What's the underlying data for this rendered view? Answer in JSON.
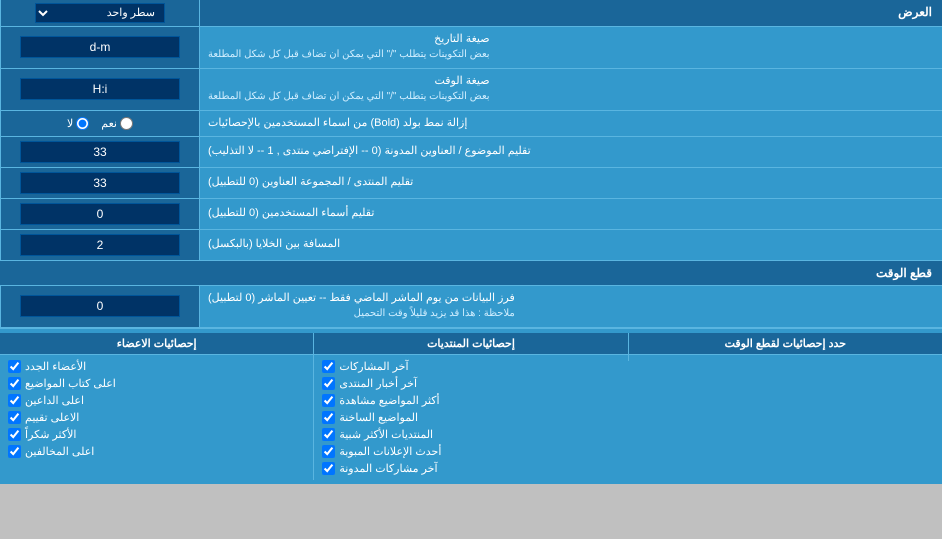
{
  "header": {
    "label": "العرض",
    "dropdown_label": "سطر واحد"
  },
  "rows": [
    {
      "id": "date-format",
      "label": "صيغة التاريخ",
      "sublabel": "بعض التكوينات يتطلب \"/\" التي يمكن ان تضاف قبل كل شكل المطلعة",
      "value": "d-m",
      "type": "input"
    },
    {
      "id": "time-format",
      "label": "صيغة الوقت",
      "sublabel": "بعض التكوينات يتطلب \"/\" التي يمكن ان تضاف قبل كل شكل المطلعة",
      "value": "H:i",
      "type": "input"
    },
    {
      "id": "bold-remove",
      "label": "إزالة نمط بولد (Bold) من اسماء المستخدمين بالإحصائيات",
      "value_yes": "نعم",
      "value_no": "لا",
      "type": "radio",
      "selected": "no"
    },
    {
      "id": "topic-limit",
      "label": "تقليم الموضوع / العناوين المدونة (0 -- الإفتراضي منتدى , 1 -- لا التذليب)",
      "value": "33",
      "type": "input"
    },
    {
      "id": "forum-limit",
      "label": "تقليم المنتدى / المجموعة العناوين (0 للتطبيل)",
      "value": "33",
      "type": "input"
    },
    {
      "id": "username-limit",
      "label": "تقليم أسماء المستخدمين (0 للتطبيل)",
      "value": "0",
      "type": "input"
    },
    {
      "id": "cell-spacing",
      "label": "المسافة بين الخلايا (بالبكسل)",
      "value": "2",
      "type": "input"
    }
  ],
  "time_cut_section": {
    "title": "قطع الوقت",
    "row": {
      "label": "فرز البيانات من يوم الماشر الماضي فقط -- تعيين الماشر (0 لتطبيل)",
      "note": "ملاحظة : هذا قد يزيد قليلاً وقت التحميل",
      "value": "0",
      "type": "input"
    }
  },
  "bottom_section": {
    "limit_label": "حدد إحصائيات لقطع الوقت",
    "col1_header": "إحصائيات المنتديات",
    "col2_header": "إحصائيات الاعضاء",
    "col1_items": [
      "آخر المشاركات",
      "آخر أخبار المنتدى",
      "أكثر المواضيع مشاهدة",
      "المواضيع الساخنة",
      "المنتديات الأكثر شبية",
      "أحدث الإعلانات المبوبة",
      "آخر مشاركات المدونة"
    ],
    "col2_items": [
      "الأعضاء الجدد",
      "اعلى كتاب المواضيع",
      "اعلى الداعين",
      "الاعلى تقييم",
      "الأكثر شكراً",
      "اعلى المخالفين"
    ]
  },
  "icons": {
    "dropdown_arrow": "▼",
    "checkbox_checked": "☑",
    "radio_on": "●",
    "radio_off": "○"
  }
}
